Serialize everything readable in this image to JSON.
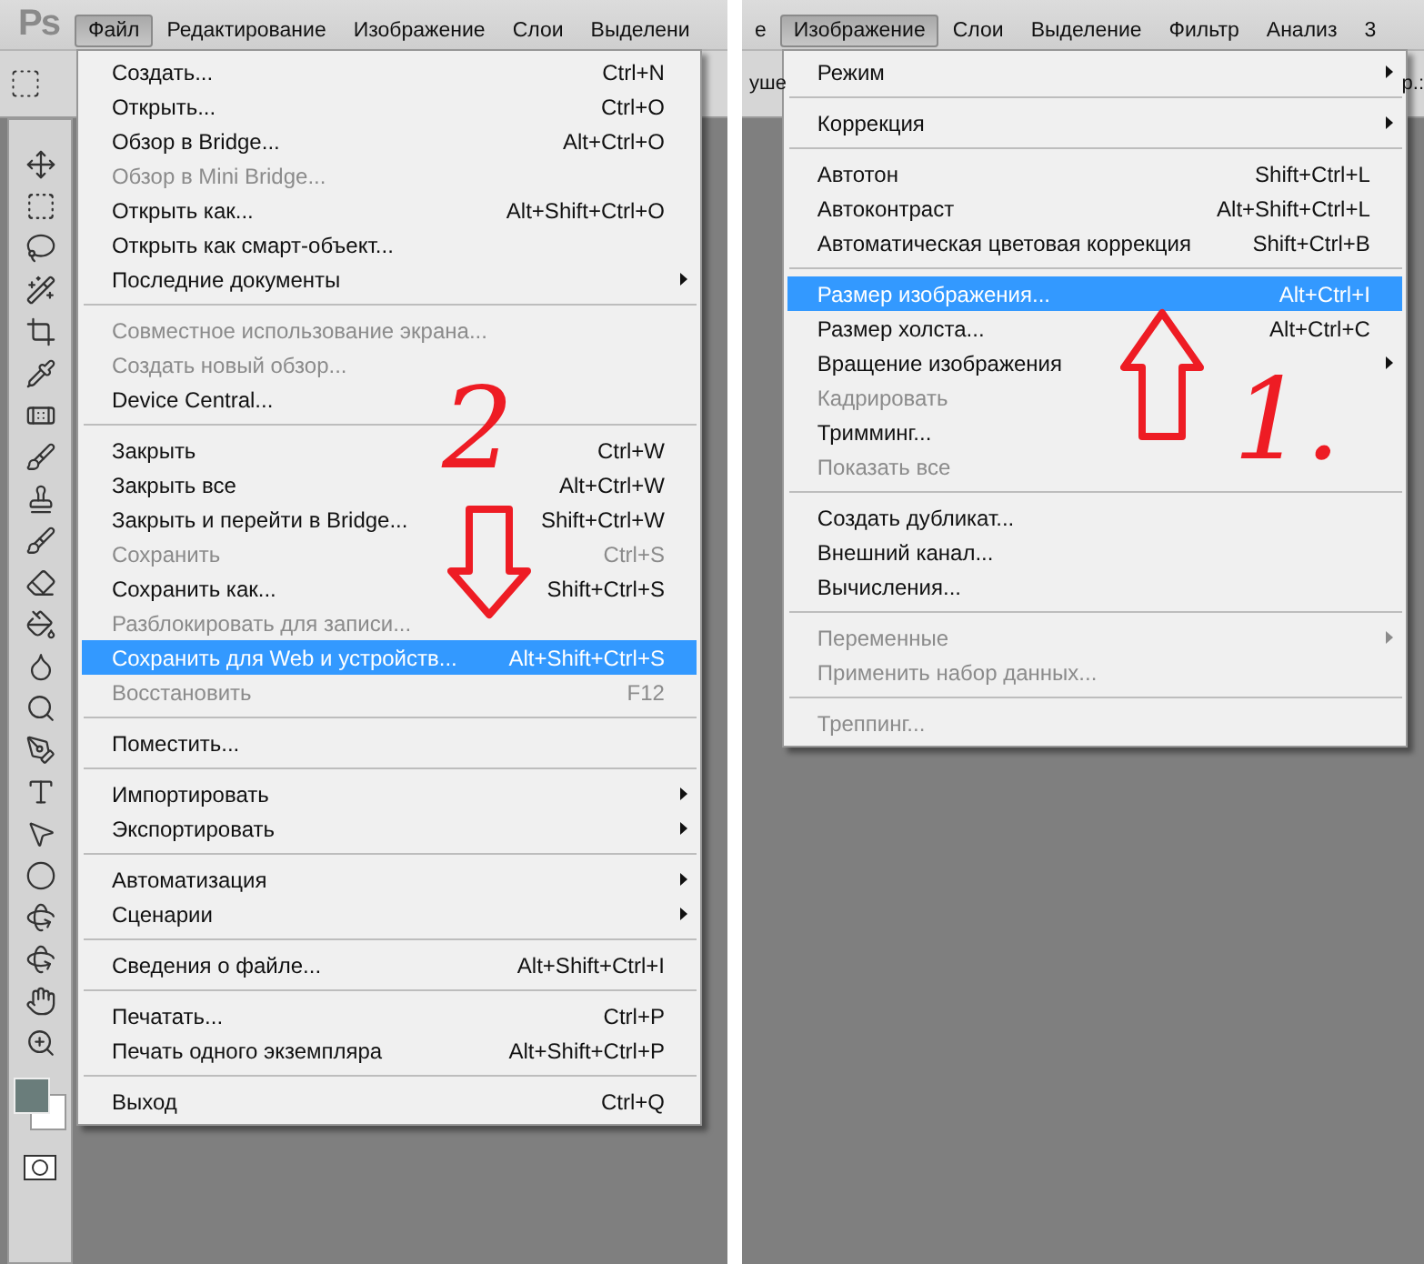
{
  "panels": [
    {
      "logo": "Ps",
      "has_toolbox": true,
      "menubar": [
        {
          "label": "Файл",
          "selected": true
        },
        {
          "label": "Редактирование",
          "selected": false
        },
        {
          "label": "Изображение",
          "selected": false
        },
        {
          "label": "Слои",
          "selected": false
        },
        {
          "label": "Выделени",
          "selected": false
        }
      ],
      "menu": {
        "groups": [
          [
            {
              "label": "Создать...",
              "shortcut": "Ctrl+N",
              "submenu": false,
              "disabled": false,
              "selected": false
            },
            {
              "label": "Открыть...",
              "shortcut": "Ctrl+O",
              "submenu": false,
              "disabled": false,
              "selected": false
            },
            {
              "label": "Обзор в Bridge...",
              "shortcut": "Alt+Ctrl+O",
              "submenu": false,
              "disabled": false,
              "selected": false
            },
            {
              "label": "Обзор в Mini Bridge...",
              "submenu": false,
              "disabled": true,
              "selected": false
            },
            {
              "label": "Открыть как...",
              "shortcut": "Alt+Shift+Ctrl+O",
              "submenu": false,
              "disabled": false,
              "selected": false
            },
            {
              "label": "Открыть как смарт-объект...",
              "submenu": false,
              "disabled": false,
              "selected": false
            },
            {
              "label": "Последние документы",
              "submenu": true,
              "disabled": false,
              "selected": false
            }
          ],
          [
            {
              "label": "Совместное использование экрана...",
              "submenu": false,
              "disabled": true,
              "selected": false
            },
            {
              "label": "Создать новый обзор...",
              "submenu": false,
              "disabled": true,
              "selected": false
            },
            {
              "label": "Device Central...",
              "submenu": false,
              "disabled": false,
              "selected": false
            }
          ],
          [
            {
              "label": "Закрыть",
              "shortcut": "Ctrl+W",
              "submenu": false,
              "disabled": false,
              "selected": false
            },
            {
              "label": "Закрыть все",
              "shortcut": "Alt+Ctrl+W",
              "submenu": false,
              "disabled": false,
              "selected": false
            },
            {
              "label": "Закрыть и перейти в Bridge...",
              "shortcut": "Shift+Ctrl+W",
              "submenu": false,
              "disabled": false,
              "selected": false
            },
            {
              "label": "Сохранить",
              "shortcut": "Ctrl+S",
              "submenu": false,
              "disabled": true,
              "selected": false
            },
            {
              "label": "Сохранить как...",
              "shortcut": "Shift+Ctrl+S",
              "submenu": false,
              "disabled": false,
              "selected": false
            },
            {
              "label": "Разблокировать для записи...",
              "submenu": false,
              "disabled": true,
              "selected": false
            },
            {
              "label": "Сохранить для Web и устройств...",
              "shortcut": "Alt+Shift+Ctrl+S",
              "submenu": false,
              "disabled": false,
              "selected": true
            },
            {
              "label": "Восстановить",
              "shortcut": "F12",
              "submenu": false,
              "disabled": true,
              "selected": false
            }
          ],
          [
            {
              "label": "Поместить...",
              "submenu": false,
              "disabled": false,
              "selected": false
            }
          ],
          [
            {
              "label": "Импортировать",
              "submenu": true,
              "disabled": false,
              "selected": false
            },
            {
              "label": "Экспортировать",
              "submenu": true,
              "disabled": false,
              "selected": false
            }
          ],
          [
            {
              "label": "Автоматизация",
              "submenu": true,
              "disabled": false,
              "selected": false
            },
            {
              "label": "Сценарии",
              "submenu": true,
              "disabled": false,
              "selected": false
            }
          ],
          [
            {
              "label": "Сведения о файле...",
              "shortcut": "Alt+Shift+Ctrl+I",
              "submenu": false,
              "disabled": false,
              "selected": false
            }
          ],
          [
            {
              "label": "Печатать...",
              "shortcut": "Ctrl+P",
              "submenu": false,
              "disabled": false,
              "selected": false
            },
            {
              "label": "Печать одного экземпляра",
              "shortcut": "Alt+Shift+Ctrl+P",
              "submenu": false,
              "disabled": false,
              "selected": false
            }
          ],
          [
            {
              "label": "Выход",
              "shortcut": "Ctrl+Q",
              "submenu": false,
              "disabled": false,
              "selected": false
            }
          ]
        ]
      },
      "annotations": [
        {
          "kind": "label",
          "text": "2"
        },
        {
          "kind": "arrow_down"
        }
      ]
    },
    {
      "has_toolbox": false,
      "options_left": "уше",
      "options_right": "р.:",
      "menubar": [
        {
          "label": "е",
          "selected": false
        },
        {
          "label": "Изображение",
          "selected": true
        },
        {
          "label": "Слои",
          "selected": false
        },
        {
          "label": "Выделение",
          "selected": false
        },
        {
          "label": "Фильтр",
          "selected": false
        },
        {
          "label": "Анализ",
          "selected": false
        },
        {
          "label": "3",
          "selected": false
        }
      ],
      "menu": {
        "groups": [
          [
            {
              "label": "Режим",
              "submenu": true,
              "disabled": false,
              "selected": false
            }
          ],
          [
            {
              "label": "Коррекция",
              "submenu": true,
              "disabled": false,
              "selected": false
            }
          ],
          [
            {
              "label": "Автотон",
              "shortcut": "Shift+Ctrl+L",
              "submenu": false,
              "disabled": false,
              "selected": false
            },
            {
              "label": "Автоконтраст",
              "shortcut": "Alt+Shift+Ctrl+L",
              "submenu": false,
              "disabled": false,
              "selected": false
            },
            {
              "label": "Автоматическая цветовая коррекция",
              "shortcut": "Shift+Ctrl+B",
              "submenu": false,
              "disabled": false,
              "selected": false
            }
          ],
          [
            {
              "label": "Размер изображения...",
              "shortcut": "Alt+Ctrl+I",
              "submenu": false,
              "disabled": false,
              "selected": true
            },
            {
              "label": "Размер холста...",
              "shortcut": "Alt+Ctrl+C",
              "submenu": false,
              "disabled": false,
              "selected": false
            },
            {
              "label": "Вращение изображения",
              "submenu": true,
              "disabled": false,
              "selected": false
            },
            {
              "label": "Кадрировать",
              "submenu": false,
              "disabled": true,
              "selected": false
            },
            {
              "label": "Тримминг...",
              "submenu": false,
              "disabled": false,
              "selected": false
            },
            {
              "label": "Показать все",
              "submenu": false,
              "disabled": true,
              "selected": false
            }
          ],
          [
            {
              "label": "Создать дубликат...",
              "submenu": false,
              "disabled": false,
              "selected": false
            },
            {
              "label": "Внешний канал...",
              "submenu": false,
              "disabled": false,
              "selected": false
            },
            {
              "label": "Вычисления...",
              "submenu": false,
              "disabled": false,
              "selected": false
            }
          ],
          [
            {
              "label": "Переменные",
              "submenu": true,
              "disabled": true,
              "selected": false
            },
            {
              "label": "Применить набор данных...",
              "submenu": false,
              "disabled": true,
              "selected": false
            }
          ],
          [
            {
              "label": "Треппинг...",
              "submenu": false,
              "disabled": true,
              "selected": false
            }
          ]
        ]
      },
      "annotations": [
        {
          "kind": "arrow_up"
        },
        {
          "kind": "label",
          "text": "1."
        }
      ]
    }
  ]
}
